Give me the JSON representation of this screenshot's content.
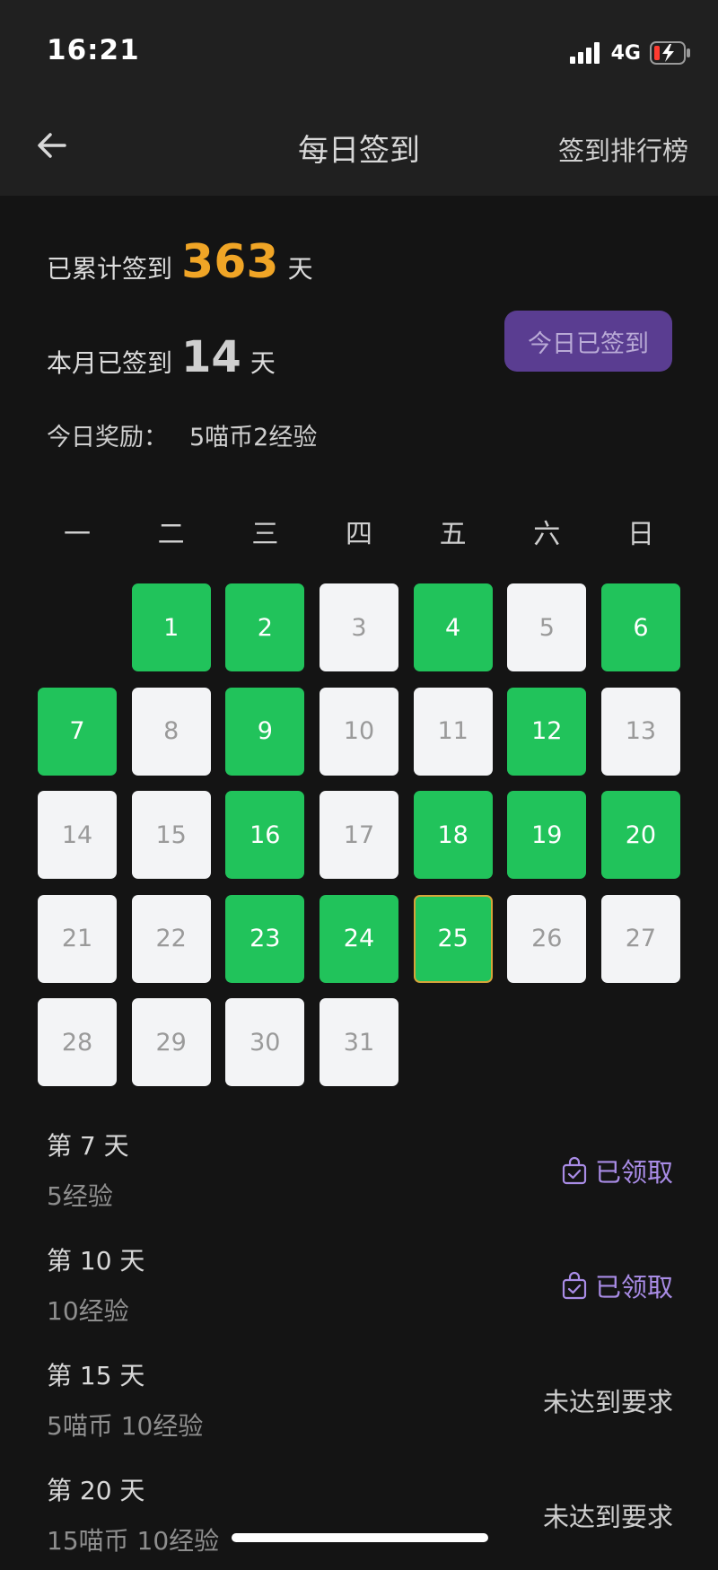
{
  "status_bar": {
    "time": "16:21",
    "network": "4G"
  },
  "nav": {
    "title": "每日签到",
    "rank_link": "签到排行榜"
  },
  "summary": {
    "total_prefix": "已累计签到",
    "total_days": "363",
    "total_suffix": "天",
    "month_prefix": "本月已签到",
    "month_days": "14",
    "month_suffix": "天",
    "reward_label": "今日奖励：",
    "reward_value": "5喵币2经验",
    "signed_button": "今日已签到"
  },
  "colors": {
    "accent_orange": "#f0a526",
    "signed_green": "#21c35b",
    "unsigned_gray": "#f3f4f6",
    "button_purple": "#5a3d91",
    "claimed_purple": "#a98ce6",
    "today_border": "#d6a43a"
  },
  "calendar": {
    "weekdays": [
      "一",
      "二",
      "三",
      "四",
      "五",
      "六",
      "日"
    ],
    "leading_blank_days": 1,
    "today": 25,
    "days": [
      {
        "day": "1",
        "signed": true
      },
      {
        "day": "2",
        "signed": true
      },
      {
        "day": "3",
        "signed": false
      },
      {
        "day": "4",
        "signed": true
      },
      {
        "day": "5",
        "signed": false
      },
      {
        "day": "6",
        "signed": true
      },
      {
        "day": "7",
        "signed": true
      },
      {
        "day": "8",
        "signed": false
      },
      {
        "day": "9",
        "signed": true
      },
      {
        "day": "10",
        "signed": false
      },
      {
        "day": "11",
        "signed": false
      },
      {
        "day": "12",
        "signed": true
      },
      {
        "day": "13",
        "signed": false
      },
      {
        "day": "14",
        "signed": false
      },
      {
        "day": "15",
        "signed": false
      },
      {
        "day": "16",
        "signed": true
      },
      {
        "day": "17",
        "signed": false
      },
      {
        "day": "18",
        "signed": true
      },
      {
        "day": "19",
        "signed": true
      },
      {
        "day": "20",
        "signed": true
      },
      {
        "day": "21",
        "signed": false
      },
      {
        "day": "22",
        "signed": false
      },
      {
        "day": "23",
        "signed": true
      },
      {
        "day": "24",
        "signed": true
      },
      {
        "day": "25",
        "signed": true
      },
      {
        "day": "26",
        "signed": false
      },
      {
        "day": "27",
        "signed": false
      },
      {
        "day": "28",
        "signed": false
      },
      {
        "day": "29",
        "signed": false
      },
      {
        "day": "30",
        "signed": false
      },
      {
        "day": "31",
        "signed": false
      }
    ]
  },
  "milestones": [
    {
      "title": "第 7 天",
      "reward": "5经验",
      "status": "已领取",
      "claimed": true,
      "icon": "gift-bag-icon"
    },
    {
      "title": "第 10 天",
      "reward": "10经验",
      "status": "已领取",
      "claimed": true,
      "icon": "gift-bag-icon"
    },
    {
      "title": "第 15 天",
      "reward": "5喵币 10经验",
      "status": "未达到要求",
      "claimed": false
    },
    {
      "title": "第 20 天",
      "reward": "15喵币 10经验",
      "status": "未达到要求",
      "claimed": false
    }
  ]
}
